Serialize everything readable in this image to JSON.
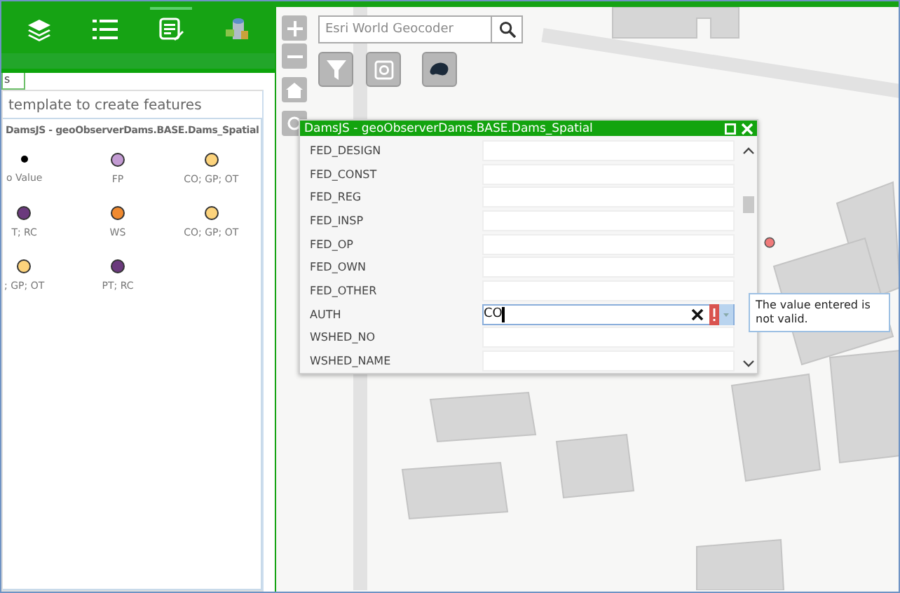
{
  "toolbar": {
    "items": [
      {
        "kind": "layers",
        "selected": false
      },
      {
        "kind": "list",
        "selected": false
      },
      {
        "kind": "edit",
        "selected": true
      },
      {
        "kind": "tools",
        "selected": false
      }
    ]
  },
  "panel": {
    "tab": "s",
    "hint": "template to create features",
    "layer_title": "DamsJS - geoObserverDams.BASE.Dams_Spatial",
    "templates": [
      {
        "label": "o Value",
        "color": "#000000",
        "kind": "dot"
      },
      {
        "label": "FP",
        "color": "#c39bd3",
        "kind": "circle"
      },
      {
        "label": "CO; GP; OT",
        "color": "#fcd37c",
        "kind": "circle"
      },
      {
        "label": "T; RC",
        "color": "#6b3a7d",
        "kind": "circle"
      },
      {
        "label": "WS",
        "color": "#f08a30",
        "kind": "circle"
      },
      {
        "label": "CO; GP; OT",
        "color": "#fcd37c",
        "kind": "circle"
      },
      {
        "label": "; GP; OT",
        "color": "#fcd37c",
        "kind": "circle"
      },
      {
        "label": "PT; RC",
        "color": "#6b3a7d",
        "kind": "circle"
      }
    ]
  },
  "search": {
    "placeholder": "Esri World Geocoder"
  },
  "popup": {
    "title": "DamsJS - geoObserverDams.BASE.Dams_Spatial",
    "fields": [
      {
        "label": "FED_DESIGN",
        "kind": "text",
        "invalid": false
      },
      {
        "label": "FED_CONST",
        "kind": "text",
        "invalid": false
      },
      {
        "label": "FED_REG",
        "kind": "text",
        "invalid": false
      },
      {
        "label": "FED_INSP",
        "kind": "text",
        "invalid": false
      },
      {
        "label": "FED_OP",
        "kind": "text",
        "invalid": false
      },
      {
        "label": "FED_OWN",
        "kind": "text",
        "invalid": false
      },
      {
        "label": "FED_OTHER",
        "kind": "text",
        "invalid": false
      },
      {
        "label": "AUTH",
        "kind": "select",
        "value": "CO",
        "invalid": true
      },
      {
        "label": "WSHED_NO",
        "kind": "text",
        "invalid": false
      },
      {
        "label": "WSHED_NAME",
        "kind": "text",
        "invalid": false
      }
    ]
  },
  "tooltip": "The value entered is not valid."
}
